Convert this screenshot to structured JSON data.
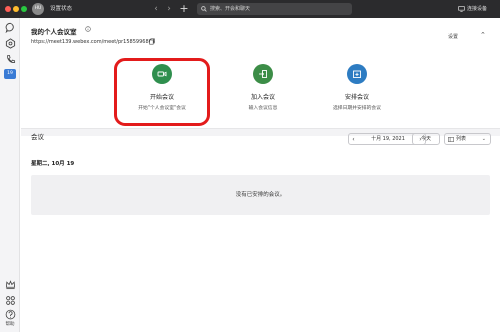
{
  "titlebar": {
    "avatar_initials": "HU",
    "status": "设置状态",
    "search_placeholder": "搜索、开会和聊天",
    "connect_device": "连接设备"
  },
  "sidebar": {
    "calendar_badge": "19",
    "help_label": "帮助"
  },
  "room": {
    "title": "我的个人会议室",
    "url": "https://meet139.webex.com/meet/pr1585996864",
    "settings": "设置"
  },
  "actions": {
    "start": {
      "title": "开始会议",
      "subtitle": "开始\"个人会议室\"会议"
    },
    "join": {
      "title": "加入会议",
      "subtitle": "输入会议信息"
    },
    "schedule": {
      "title": "安排会议",
      "subtitle": "选择日期并安排的会议"
    }
  },
  "meetings": {
    "section_title": "会议",
    "date": "十月 19, 2021",
    "today": "今天",
    "view": "列表",
    "day_label": "星期二, 10月 19",
    "empty_text": "没有已安排的会议。"
  },
  "colors": {
    "titlebar": "#2b2b2d",
    "start_green": "#2f8f4e",
    "schedule_blue": "#2d7cc2",
    "highlight_red": "#e31b1b",
    "badge_blue": "#3a7bd5"
  }
}
